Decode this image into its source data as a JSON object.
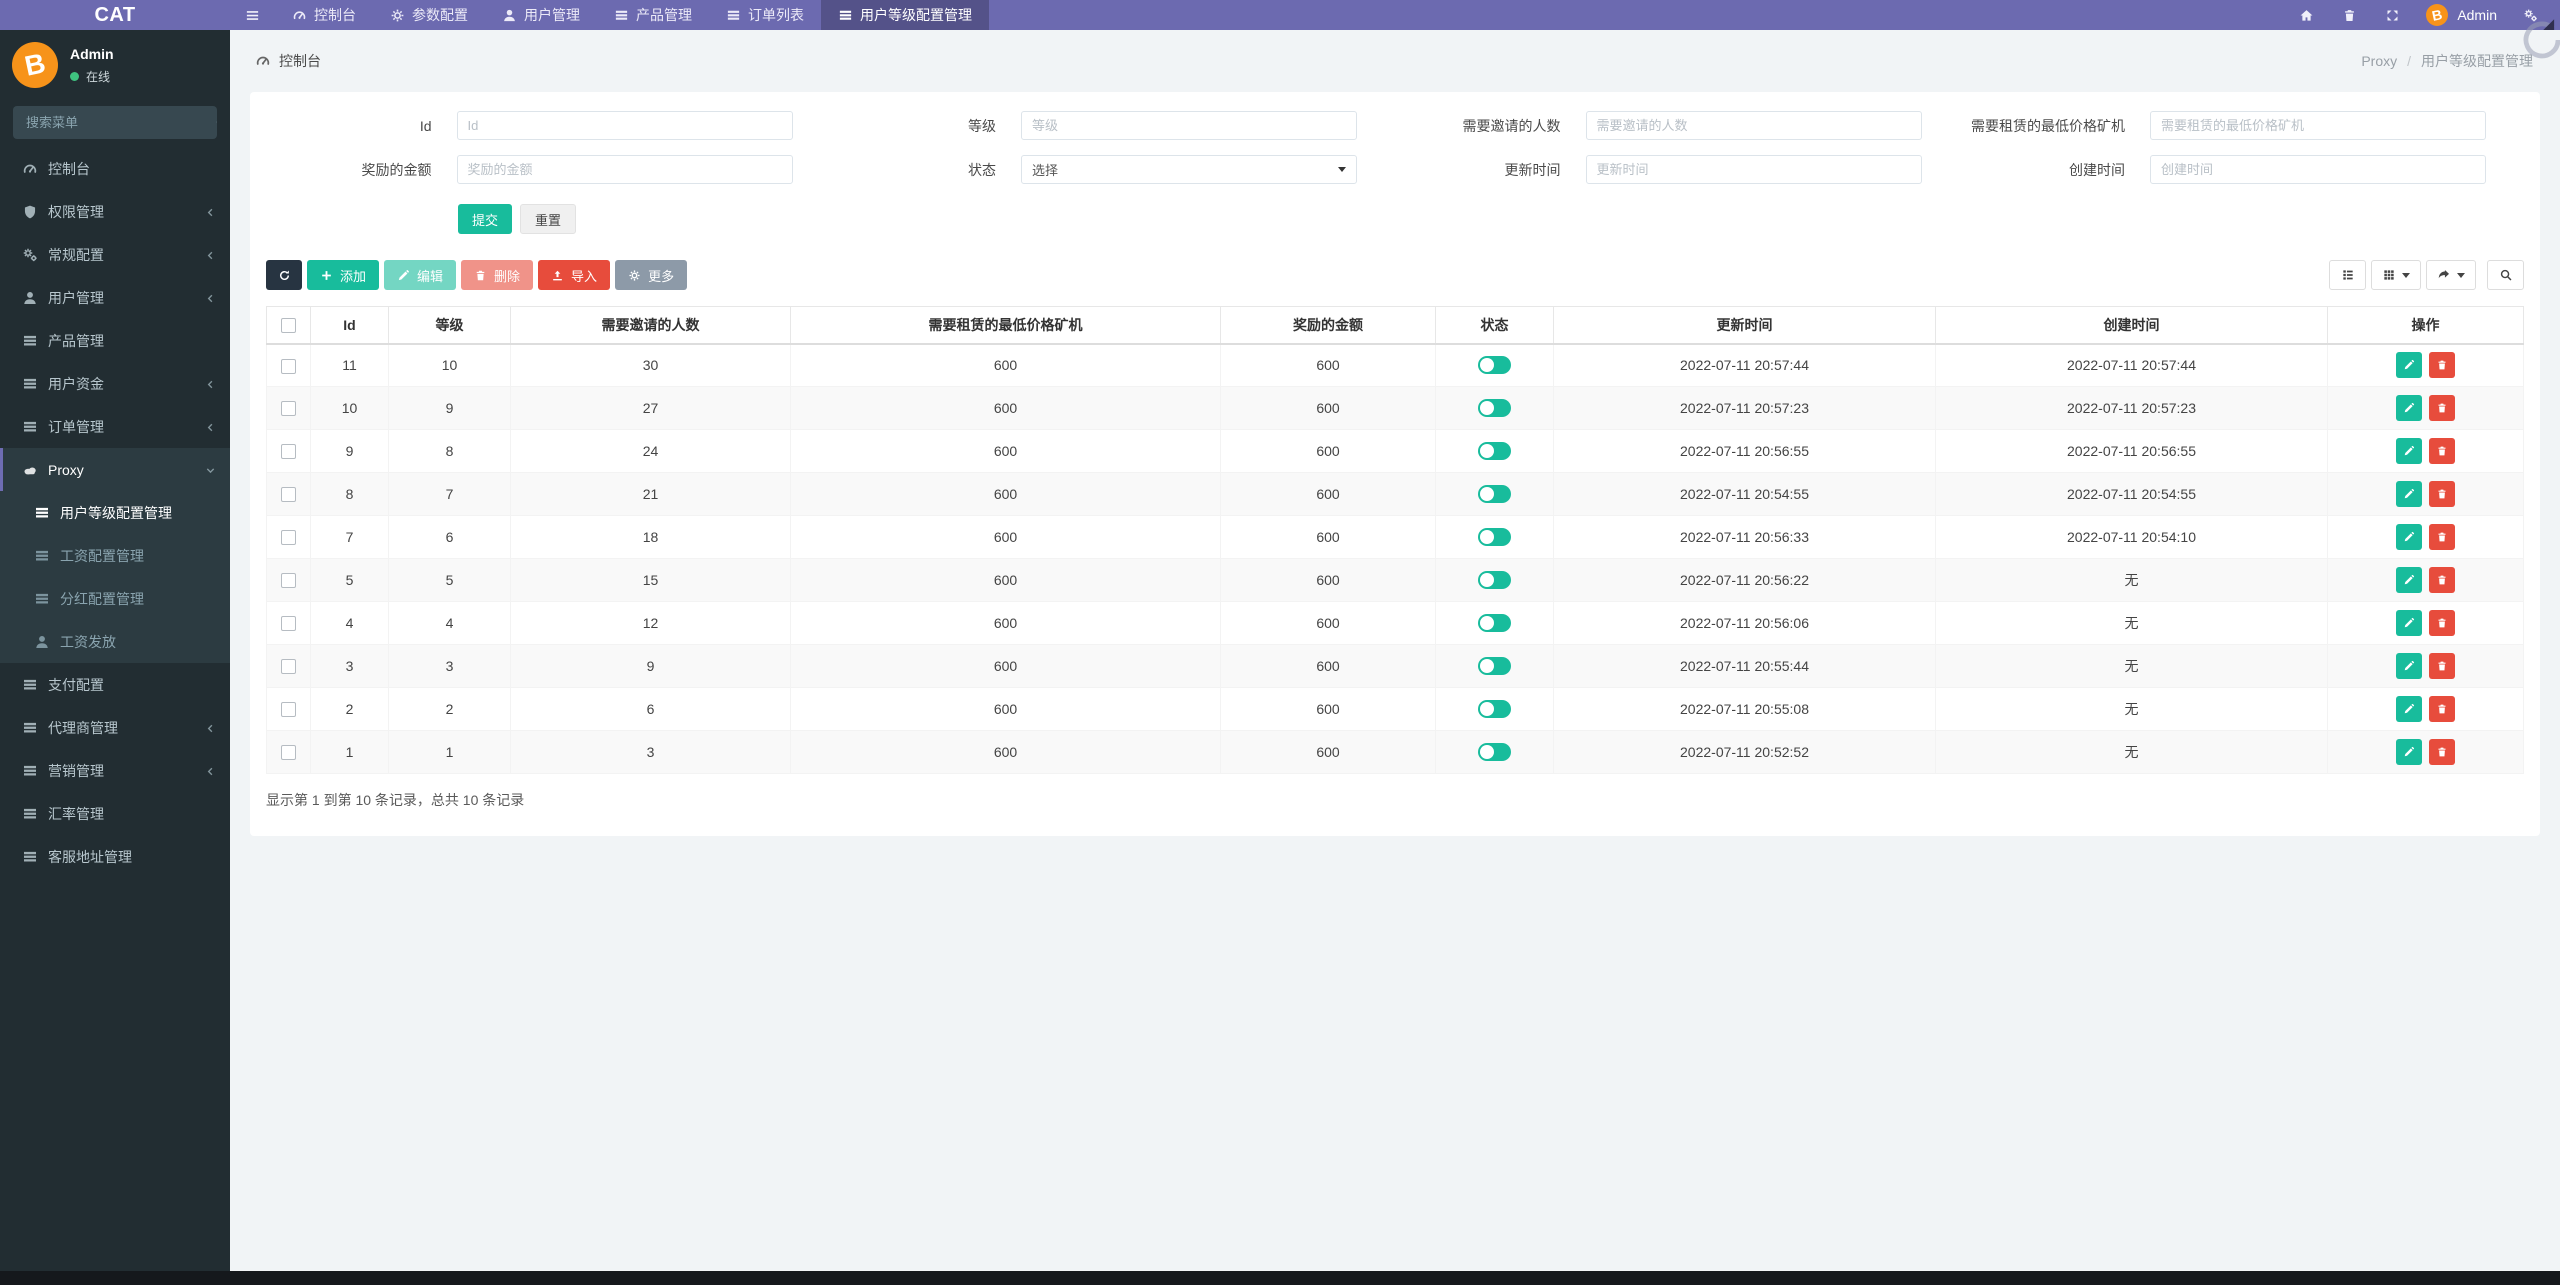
{
  "navbar": {
    "brand": "CAT",
    "items": [
      {
        "label": "控制台",
        "icon": "dashboard-icon",
        "active": false
      },
      {
        "label": "参数配置",
        "icon": "gear-icon",
        "active": false
      },
      {
        "label": "用户管理",
        "icon": "user-icon",
        "active": false
      },
      {
        "label": "产品管理",
        "icon": "list-icon",
        "active": false
      },
      {
        "label": "订单列表",
        "icon": "list-icon",
        "active": false
      },
      {
        "label": "用户等级配置管理",
        "icon": "list-icon",
        "active": true
      }
    ],
    "right_icons": [
      "home-icon",
      "trash-icon",
      "expand-icon",
      "cogs-icon"
    ],
    "user_name": "Admin",
    "avatar_glyph": "B"
  },
  "sidebar": {
    "user_name": "Admin",
    "user_status": "在线",
    "search_placeholder": "搜索菜单",
    "items": [
      {
        "label": "控制台",
        "icon": "dashboard-icon"
      },
      {
        "label": "权限管理",
        "icon": "shield-icon",
        "expandable": true
      },
      {
        "label": "常规配置",
        "icon": "cogs-icon",
        "expandable": true
      },
      {
        "label": "用户管理",
        "icon": "user-icon",
        "expandable": true
      },
      {
        "label": "产品管理",
        "icon": "list-icon"
      },
      {
        "label": "用户资金",
        "icon": "list-icon",
        "expandable": true
      },
      {
        "label": "订单管理",
        "icon": "list-icon",
        "expandable": true
      },
      {
        "label": "Proxy",
        "icon": "cloud-icon",
        "expandable": true,
        "open": true
      },
      {
        "label": "支付配置",
        "icon": "list-icon"
      },
      {
        "label": "代理商管理",
        "icon": "list-icon",
        "expandable": true
      },
      {
        "label": "营销管理",
        "icon": "list-icon",
        "expandable": true
      },
      {
        "label": "汇率管理",
        "icon": "list-icon"
      },
      {
        "label": "客服地址管理",
        "icon": "list-icon"
      }
    ],
    "proxy_children": [
      {
        "label": "用户等级配置管理",
        "icon": "list-icon",
        "active": true
      },
      {
        "label": "工资配置管理",
        "icon": "list-icon"
      },
      {
        "label": "分红配置管理",
        "icon": "list-icon"
      },
      {
        "label": "工资发放",
        "icon": "user-icon"
      }
    ]
  },
  "header": {
    "title": "控制台",
    "breadcrumb_parent": "Proxy",
    "breadcrumb_separator": "/",
    "breadcrumb_current": "用户等级配置管理"
  },
  "filters": {
    "row1": [
      {
        "label": "Id",
        "placeholder": "Id"
      },
      {
        "label": "等级",
        "placeholder": "等级"
      },
      {
        "label": "需要邀请的人数",
        "placeholder": "需要邀请的人数"
      },
      {
        "label": "需要租赁的最低价格矿机",
        "placeholder": "需要租赁的最低价格矿机"
      }
    ],
    "row2": [
      {
        "label": "奖励的金额",
        "placeholder": "奖励的金额"
      },
      {
        "label": "状态",
        "value": "选择"
      },
      {
        "label": "更新时间",
        "placeholder": "更新时间"
      },
      {
        "label": "创建时间",
        "placeholder": "创建时间"
      }
    ],
    "submit_label": "提交",
    "reset_label": "重置"
  },
  "toolbar": {
    "add_label": "添加",
    "edit_label": "编辑",
    "delete_label": "删除",
    "import_label": "导入",
    "more_label": "更多"
  },
  "table": {
    "columns": [
      "Id",
      "等级",
      "需要邀请的人数",
      "需要租赁的最低价格矿机",
      "奖励的金额",
      "状态",
      "更新时间",
      "创建时间",
      "操作"
    ],
    "rows": [
      {
        "id": "11",
        "level": "10",
        "invites": "30",
        "min_miner": "600",
        "reward": "600",
        "status": "on",
        "updated": "2022-07-11 20:57:44",
        "created": "2022-07-11 20:57:44"
      },
      {
        "id": "10",
        "level": "9",
        "invites": "27",
        "min_miner": "600",
        "reward": "600",
        "status": "on",
        "updated": "2022-07-11 20:57:23",
        "created": "2022-07-11 20:57:23"
      },
      {
        "id": "9",
        "level": "8",
        "invites": "24",
        "min_miner": "600",
        "reward": "600",
        "status": "on",
        "updated": "2022-07-11 20:56:55",
        "created": "2022-07-11 20:56:55"
      },
      {
        "id": "8",
        "level": "7",
        "invites": "21",
        "min_miner": "600",
        "reward": "600",
        "status": "on",
        "updated": "2022-07-11 20:54:55",
        "created": "2022-07-11 20:54:55"
      },
      {
        "id": "7",
        "level": "6",
        "invites": "18",
        "min_miner": "600",
        "reward": "600",
        "status": "on",
        "updated": "2022-07-11 20:56:33",
        "created": "2022-07-11 20:54:10"
      },
      {
        "id": "5",
        "level": "5",
        "invites": "15",
        "min_miner": "600",
        "reward": "600",
        "status": "on",
        "updated": "2022-07-11 20:56:22",
        "created": "无"
      },
      {
        "id": "4",
        "level": "4",
        "invites": "12",
        "min_miner": "600",
        "reward": "600",
        "status": "on",
        "updated": "2022-07-11 20:56:06",
        "created": "无"
      },
      {
        "id": "3",
        "level": "3",
        "invites": "9",
        "min_miner": "600",
        "reward": "600",
        "status": "on",
        "updated": "2022-07-11 20:55:44",
        "created": "无"
      },
      {
        "id": "2",
        "level": "2",
        "invites": "6",
        "min_miner": "600",
        "reward": "600",
        "status": "on",
        "updated": "2022-07-11 20:55:08",
        "created": "无"
      },
      {
        "id": "1",
        "level": "1",
        "invites": "3",
        "min_miner": "600",
        "reward": "600",
        "status": "on",
        "updated": "2022-07-11 20:52:52",
        "created": "无"
      }
    ],
    "summary": "显示第 1 到第 10 条记录，总共 10 条记录"
  },
  "colors": {
    "navbar": "#6c6ab0",
    "sidebar": "#222d32",
    "accent": "#18bc9c",
    "danger": "#e74c3c",
    "avatar": "#f7931a"
  }
}
